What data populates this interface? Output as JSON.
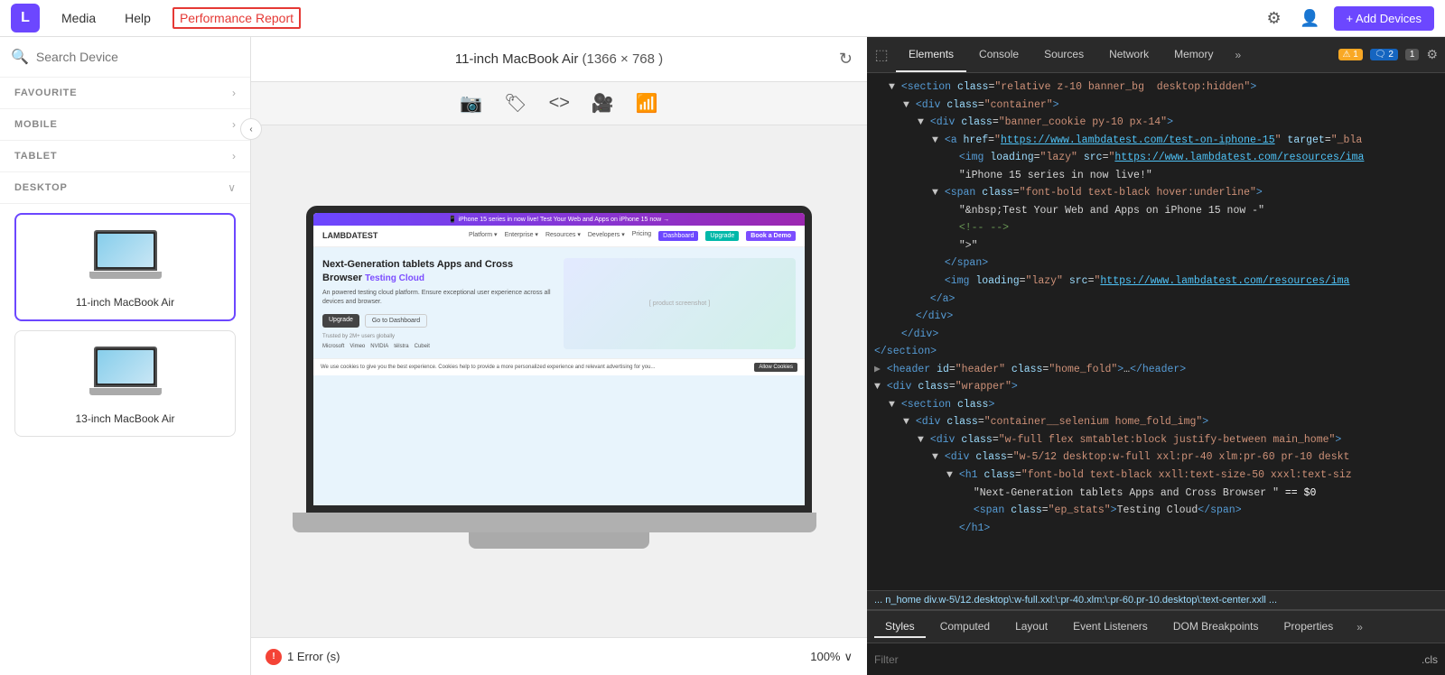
{
  "nav": {
    "logo_letter": "L",
    "items": [
      {
        "label": "Media",
        "active": false
      },
      {
        "label": "Help",
        "active": false
      },
      {
        "label": "Performance Report",
        "active": true
      }
    ],
    "add_devices_label": "+ Add Devices"
  },
  "sidebar": {
    "search_placeholder": "Search Device",
    "sections": [
      {
        "label": "FAVOURITE",
        "expanded": false
      },
      {
        "label": "MOBILE",
        "expanded": false
      },
      {
        "label": "TABLET",
        "expanded": false
      },
      {
        "label": "DESKTOP",
        "expanded": true
      }
    ],
    "devices": [
      {
        "name": "11-inch MacBook Air",
        "selected": true
      },
      {
        "name": "13-inch MacBook Air",
        "selected": false
      }
    ]
  },
  "preview": {
    "title": "11-inch MacBook Air",
    "dimensions": "(1366 × 768 )",
    "error_label": "1 Error (s)",
    "zoom": "100%"
  },
  "devtools": {
    "tabs": [
      "Elements",
      "Console",
      "Sources",
      "Network",
      "Memory"
    ],
    "more_label": "»",
    "badge_warning": "1",
    "badge_error": "2",
    "badge_info": "1",
    "code_lines": [
      {
        "indent": 1,
        "content": "<section class=\"relative z-10 banner_bg  desktop:hidden\">"
      },
      {
        "indent": 2,
        "content": "<div class=\"container\">"
      },
      {
        "indent": 3,
        "content": "<div class=\"banner_cookie py-10 px-14\">"
      },
      {
        "indent": 4,
        "content": "<a href=\"https://www.lambdatest.com/test-on-iphone-15\" target=\"_bla"
      },
      {
        "indent": 5,
        "content": "<img loading=\"lazy\" src=\"https://www.lambdatest.com/resources/ima"
      },
      {
        "indent": 5,
        "content": "\"iPhone 15 series in now live!\""
      },
      {
        "indent": 4,
        "content": "<span class=\"font-bold text-black hover:underline\">"
      },
      {
        "indent": 5,
        "content": "\"&nbsp;Test Your Web and Apps on iPhone 15 now -\""
      },
      {
        "indent": 5,
        "content": "<!-- -->"
      },
      {
        "indent": 5,
        "content": "\">\""
      },
      {
        "indent": 4,
        "content": "</span>"
      },
      {
        "indent": 4,
        "content": "<img loading=\"lazy\" src=\"https://www.lambdatest.com/resources/ima"
      },
      {
        "indent": 3,
        "content": "</a>"
      },
      {
        "indent": 2,
        "content": "</div>"
      },
      {
        "indent": 1,
        "content": "</div>"
      },
      {
        "indent": 0,
        "content": "</section>"
      },
      {
        "indent": 0,
        "content": "<header id=\"header\" class=\"home_fold\">…</header>"
      },
      {
        "indent": 0,
        "content": "<div class=\"wrapper\">"
      },
      {
        "indent": 1,
        "content": "<section class>"
      },
      {
        "indent": 2,
        "content": "<div class=\"container__selenium home_fold_img\">"
      },
      {
        "indent": 3,
        "content": "<div class=\"w-full flex smtablet:block justify-between main_home\">"
      },
      {
        "indent": 4,
        "content": "<div class=\"w-5/12 desktop:w-full xxl:pr-40 xlm:pr-60 pr-10 deskt"
      },
      {
        "indent": 5,
        "content": "<h1 class=\"font-bold text-black xxll:text-size-50 xxxl:text-siz"
      },
      {
        "indent": 6,
        "content": "\"Next-Generation tablets Apps and Cross Browser \" == $0"
      },
      {
        "indent": 6,
        "content": "<span class=\"ep_stats\">Testing Cloud</span>"
      },
      {
        "indent": 5,
        "content": "</h1>"
      }
    ],
    "breadcrumb": "... n_home  div.w-5\\/12.desktop\\:w-full.xxl:\\:pr-40.xlm:\\:pr-60.pr-10.desktop\\:text-center.xxll  ...",
    "bottom_tabs": [
      "Styles",
      "Computed",
      "Layout",
      "Event Listeners",
      "DOM Breakpoints",
      "Properties",
      "»"
    ],
    "filter_placeholder": "Filter",
    "filter_icon": ".cls"
  }
}
